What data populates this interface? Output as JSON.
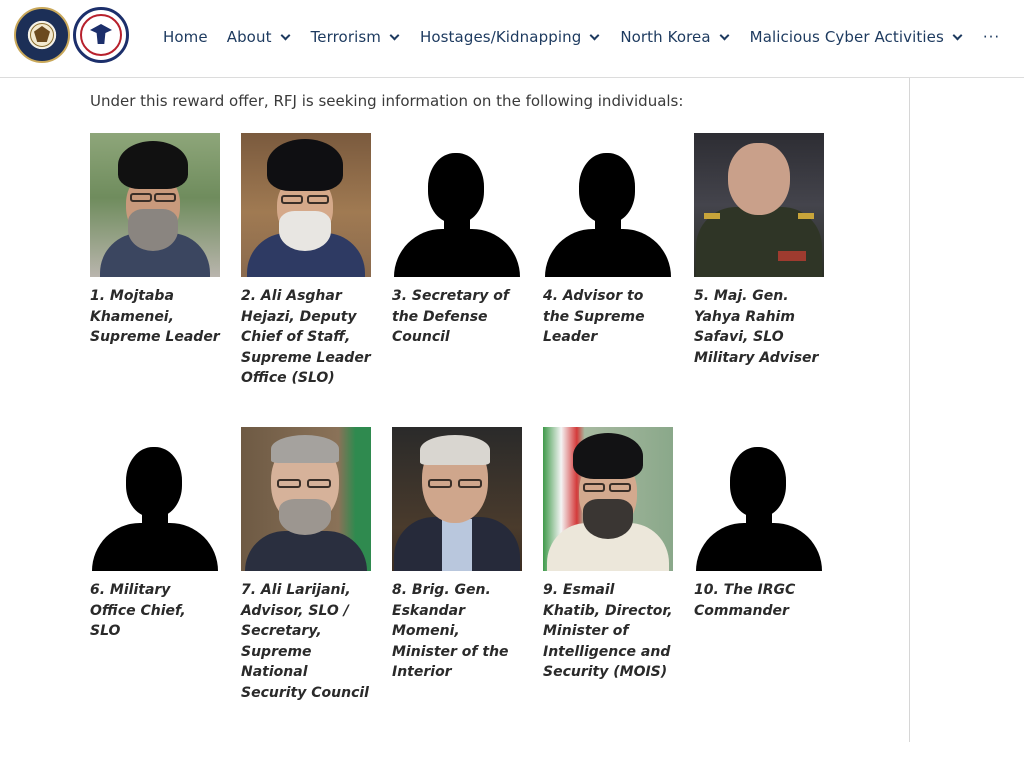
{
  "header": {
    "logos": [
      {
        "name": "department-of-state-seal",
        "icon": "state-department-seal-icon"
      },
      {
        "name": "rewards-for-justice-seal",
        "icon": "rfj-seal-icon"
      }
    ],
    "nav": [
      {
        "label": "Home",
        "has_dropdown": false
      },
      {
        "label": "About",
        "has_dropdown": true
      },
      {
        "label": "Terrorism",
        "has_dropdown": true
      },
      {
        "label": "Hostages/Kidnapping",
        "has_dropdown": true
      },
      {
        "label": "North Korea",
        "has_dropdown": true
      },
      {
        "label": "Malicious Cyber Activities",
        "has_dropdown": true
      }
    ],
    "more_label": "···"
  },
  "intro": "Under this reward offer, RFJ is seeking information on the following individuals:",
  "individuals": [
    {
      "caption": "1. Mojtaba Khamenei, Supreme Leader",
      "photo": "portrait"
    },
    {
      "caption": "2. Ali Asghar Hejazi, Deputy Chief of Staff, Supreme Leader Office (SLO)",
      "photo": "portrait"
    },
    {
      "caption": "3. Secretary of the Defense Council",
      "photo": "silhouette"
    },
    {
      "caption": "4. Advisor to the Supreme Leader",
      "photo": "silhouette"
    },
    {
      "caption": "5. Maj. Gen. Yahya Rahim Safavi, SLO Military Adviser",
      "photo": "portrait"
    },
    {
      "caption": "6. Military Office Chief, SLO",
      "photo": "silhouette"
    },
    {
      "caption": "7. Ali Larijani, Advisor, SLO / Secretary, Supreme National Security Council",
      "photo": "portrait"
    },
    {
      "caption": "8. Brig. Gen. Eskandar Momeni, Minister of the Interior",
      "photo": "portrait"
    },
    {
      "caption": "9. Esmail Khatib, Director, Minister of Intelligence and Security (MOIS)",
      "photo": "portrait"
    },
    {
      "caption": "10. The IRGC Commander",
      "photo": "silhouette"
    }
  ],
  "colors": {
    "nav_text": "#1d3a5f",
    "caption_text": "#2a2a2a",
    "divider": "#d6d6d6"
  }
}
